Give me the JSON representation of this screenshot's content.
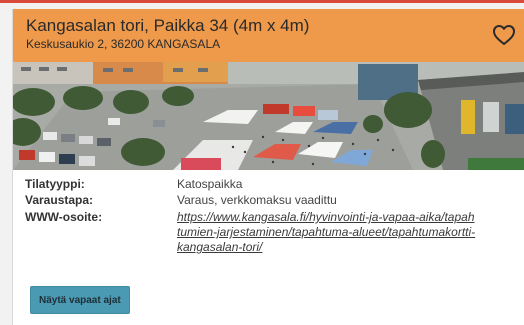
{
  "listing": {
    "title": "Kangasalan tori, Paikka 34 (4m x 4m)",
    "address": "Keskusaukio 2, 36200 KANGASALA",
    "favorite_icon": "heart-outline-icon"
  },
  "photo": {
    "subject": "aerial market square with tents and people"
  },
  "details": {
    "space_type_label": "Tilatyyppi:",
    "space_type_value": "Katospaikka",
    "booking_label": "Varaustapa:",
    "booking_value": "Varaus, verkkomaksu vaadittu",
    "www_label": "WWW-osoite:",
    "www_value": "https://www.kangasala.fi/hyvinvointi-ja-vapaa-aika/tapahtumien-jarjestaminen/tapahtuma-alueet/tapahtumakortti-kangasalan-tori/"
  },
  "actions": {
    "show_free_times_label": "Näytä vapaat ajat"
  },
  "colors": {
    "header_bg": "#ef9a4a",
    "button_bg": "#4b9ab4",
    "top_strip": "#d84a3a"
  }
}
